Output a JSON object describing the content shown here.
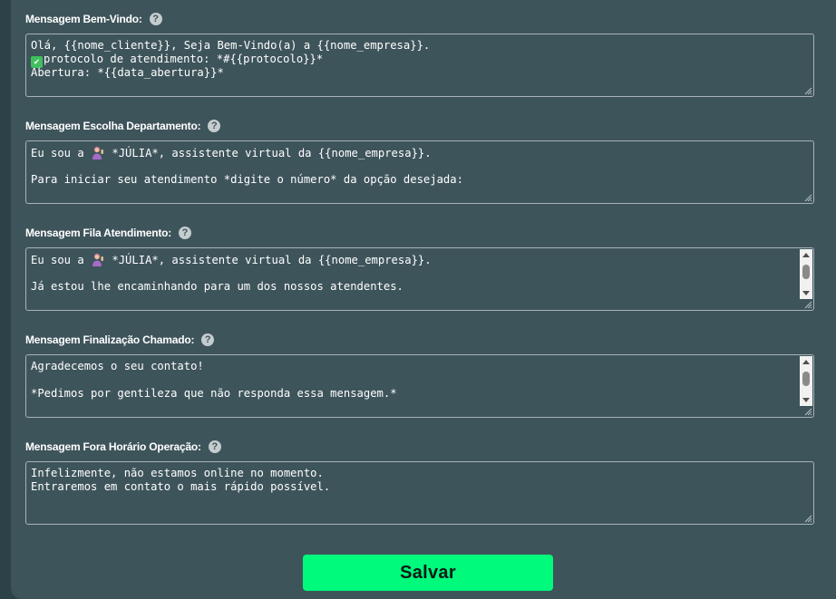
{
  "colors": {
    "page_bg": "#2c4148",
    "panel_bg": "#3e545b",
    "border": "#a7b3b6",
    "accent_button": "#00fa7c"
  },
  "fields": [
    {
      "label": "Mensagem Bem-Vindo:",
      "lines": [
        "Olá, {{nome_cliente}}, Seja Bem-Vindo(a) a {{nome_empresa}}.",
        "protocolo de atendimento: *#{{protocolo}}*",
        "Abertura: *{{data_abertura}}*"
      ]
    },
    {
      "label": "Mensagem Escolha Departamento:",
      "lines": [
        "Eu sou a",
        " *JÚLIA*, assistente virtual da {{nome_empresa}}.",
        "",
        "Para iniciar seu atendimento *digite o número* da opção desejada:"
      ]
    },
    {
      "label": "Mensagem Fila Atendimento:",
      "lines": [
        "Eu sou a",
        " *JÚLIA*, assistente virtual da {{nome_empresa}}.",
        "",
        "Já estou lhe encaminhando para um dos nossos atendentes."
      ]
    },
    {
      "label": "Mensagem Finalização Chamado:",
      "lines": [
        "Agradecemos o seu contato!",
        "",
        "*Pedimos por gentileza que não responda essa mensagem.*"
      ]
    },
    {
      "label": "Mensagem Fora Horário Operação:",
      "lines": [
        "Infelizmente, não estamos online no momento.",
        "Entraremos em contato o mais rápido possível."
      ]
    }
  ],
  "icons": {
    "help": "question-circle-icon",
    "check": "check-mark-button-emoji",
    "woman": "woman-tipping-hand-emoji"
  },
  "save_label": "Salvar"
}
